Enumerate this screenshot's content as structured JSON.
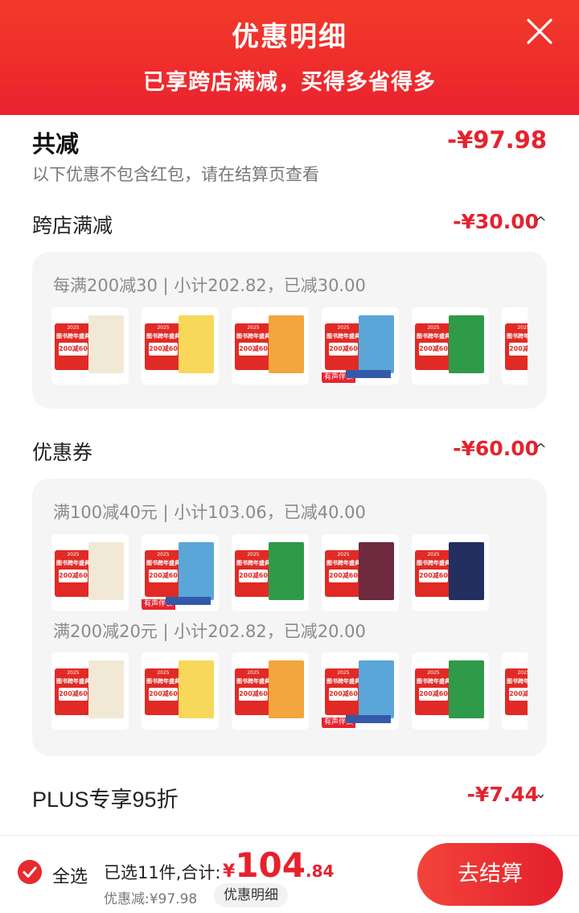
{
  "header": {
    "title": "优惠明细",
    "subtitle": "已享跨店满减，买得多省得多",
    "close_icon": "close-icon"
  },
  "summary": {
    "label": "共减",
    "value": "-¥97.98",
    "note": "以下优惠不包含红包，请在结算页查看"
  },
  "sections": [
    {
      "label": "跨店满减",
      "value": "-¥30.00",
      "chevron": "^",
      "rules": [
        {
          "text": "每满200减30 | 小计202.82，已减30.00",
          "thumbs": [
            "#f1e9d6",
            "#f7d85b",
            "#f2a63d",
            "#5aa6d8",
            "#2f9a4a",
            "#e6e6e6"
          ]
        }
      ]
    },
    {
      "label": "优惠券",
      "value": "-¥60.00",
      "chevron": "^",
      "rules": [
        {
          "text": "满100减40元 | 小计103.06，已减40.00",
          "thumbs": [
            "#f1e9d6",
            "#5aa6d8",
            "#2f9a4a",
            "#6e2a3f",
            "#23305f"
          ]
        },
        {
          "text": "满200减20元 | 小计202.82，已减20.00",
          "thumbs": [
            "#f1e9d6",
            "#f7d85b",
            "#f2a63d",
            "#5aa6d8",
            "#2f9a4a",
            "#e6e6e6"
          ]
        }
      ]
    },
    {
      "label": "PLUS专享95折",
      "value": "-¥7.44",
      "chevron": "⌄",
      "rules": []
    }
  ],
  "promo_label": {
    "year": "2025",
    "title": "图书跨年盛典",
    "deal": "200减60"
  },
  "audio_tag": "有声伴读",
  "footer": {
    "select_all": "全选",
    "selected_text": "已选11件,合计:",
    "price_currency": "¥",
    "price_int": "104",
    "price_dec": ".84",
    "discount_text": "优惠减:¥97.98",
    "detail_button": "优惠明细",
    "checkout_button": "去结算"
  },
  "colors": {
    "brand_red": "#e5222e",
    "header_red": "#ef2c2c"
  }
}
